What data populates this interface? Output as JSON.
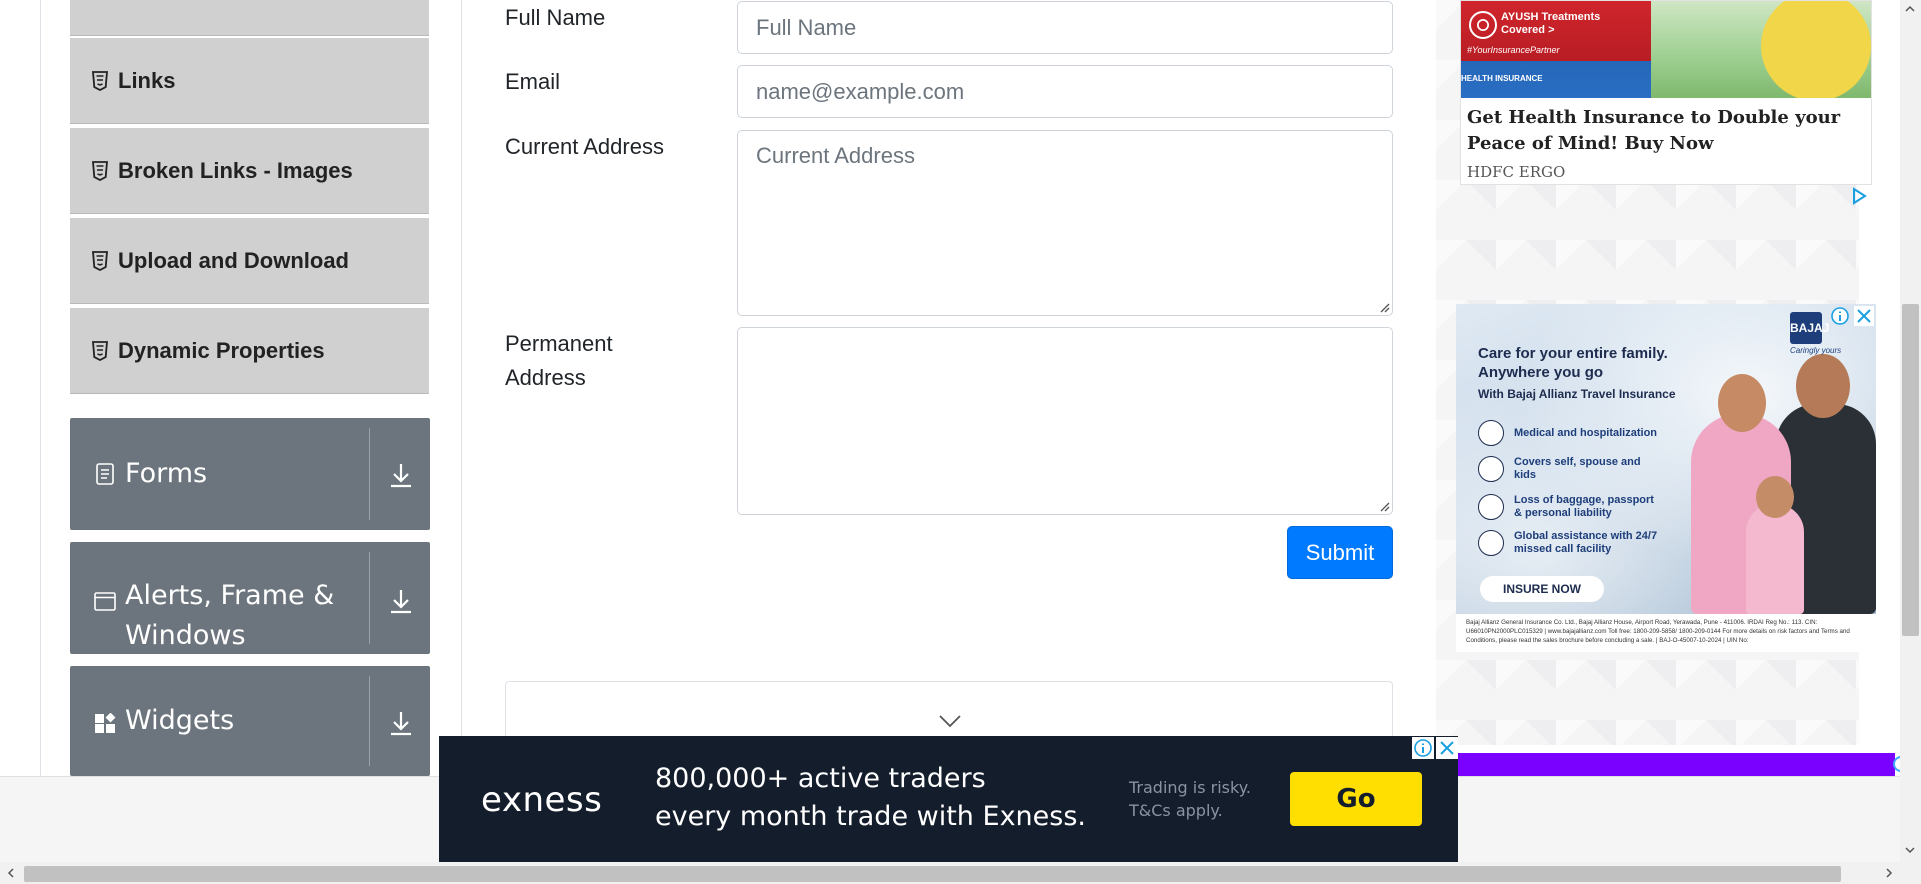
{
  "sidebar": {
    "items": [
      {
        "label": "Links"
      },
      {
        "label": "Broken Links - Images"
      },
      {
        "label": "Upload and Download"
      },
      {
        "label": "Dynamic Properties"
      }
    ],
    "groups": [
      {
        "label": "Forms"
      },
      {
        "label": "Alerts, Frame & Windows"
      },
      {
        "label": "Widgets"
      }
    ]
  },
  "form": {
    "full_name_label": "Full Name",
    "full_name_placeholder": "Full Name",
    "email_label": "Email",
    "email_placeholder": "name@example.com",
    "current_address_label": "Current Address",
    "current_address_placeholder": "Current Address",
    "permanent_address_label": "Permanent Address",
    "submit_label": "Submit"
  },
  "ads": {
    "hdfc": {
      "badge": "AYUSH Treatments Covered >",
      "hashtag": "#YourInsurancePartner",
      "strip": "HEALTH INSURANCE",
      "headline": "Get Health Insurance to Double your Peace of Mind! Buy Now",
      "brand": "HDFC ERGO"
    },
    "bajaj": {
      "headline": "Care for your entire family. Anywhere you go",
      "subline": "With Bajaj Allianz Travel Insurance",
      "features": [
        "Medical and hospitalization",
        "Covers self, spouse and kids",
        "Loss of baggage, passport & personal liability",
        "Global assistance with 24/7 missed call facility"
      ],
      "cta": "INSURE NOW",
      "logo": "BAJAJ",
      "tagline": "Caringly yours",
      "footer": "Bajaj Allianz General Insurance Co. Ltd., Bajaj Allianz House, Airport Road, Yerawada, Pune - 411006. IRDAI Reg No.: 113. CIN: U66010PN2000PLC015329 | www.bajajallianz.com Toll free: 1800-209-5858/ 1800-209-0144 For more details on risk factors and Terms and Conditions, please read the sales brochure before concluding a sale. | BAJ-O-45007-10-2024 | UIN No:"
    },
    "exness": {
      "logo": "exness",
      "line1": "800,000+ active traders",
      "line2": "every month trade with Exness.",
      "risk1": "Trading is risky.",
      "risk2": "T&Cs apply.",
      "cta": "Go"
    }
  },
  "colors": {
    "primary": "#007bff",
    "sidebar_item_bg": "#d0d0d0",
    "group_bg": "#6c757d",
    "exness_yellow": "#ffde02",
    "promo_purple": "#7a00ff"
  }
}
